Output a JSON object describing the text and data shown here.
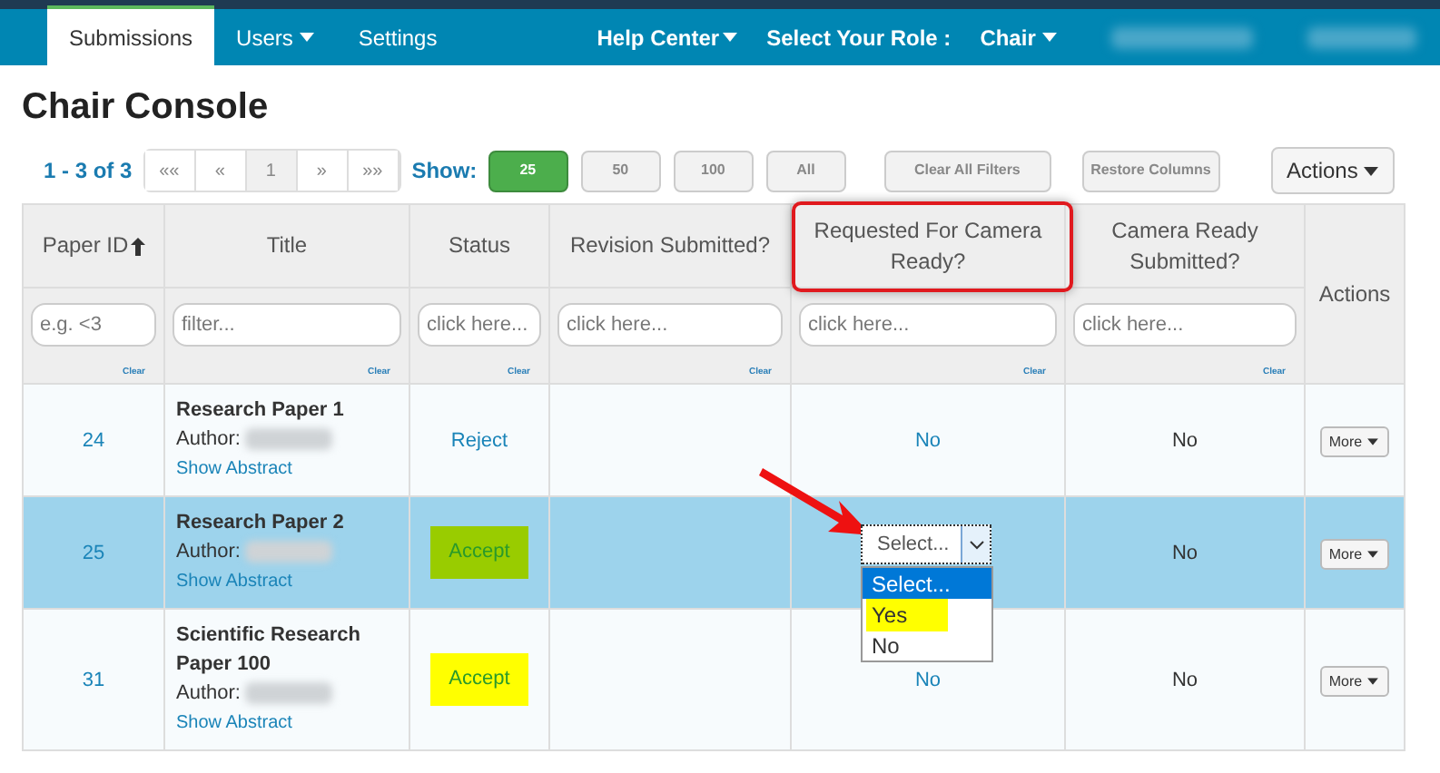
{
  "nav": {
    "tabs": [
      {
        "label": "Submissions",
        "selected": true,
        "caret": false
      },
      {
        "label": "Users",
        "selected": false,
        "caret": true
      },
      {
        "label": "Settings",
        "selected": false,
        "caret": false
      }
    ],
    "help": "Help Center",
    "role_label": "Select Your Role :",
    "role": "Chair"
  },
  "page_title": "Chair Console",
  "toolbar": {
    "range": "1 - 3 of 3",
    "pager": [
      {
        "label": "««",
        "selected": false
      },
      {
        "label": "«",
        "selected": false
      },
      {
        "label": "1",
        "selected": true
      },
      {
        "label": "»",
        "selected": false
      },
      {
        "label": "»»",
        "selected": false
      }
    ],
    "show_label": "Show:",
    "show": [
      {
        "label": "25",
        "selected": true
      },
      {
        "label": "50",
        "selected": false
      },
      {
        "label": "100",
        "selected": false
      },
      {
        "label": "All",
        "selected": false
      }
    ],
    "clear": "Clear All Filters",
    "restore": "Restore Columns",
    "actions": "Actions"
  },
  "table": {
    "columns": [
      {
        "label": "Paper ID",
        "sorted": true,
        "placeholder": "e.g. <3",
        "clear": "Clear",
        "highlighted": false
      },
      {
        "label": "Title",
        "sorted": false,
        "placeholder": "filter...",
        "clear": "Clear",
        "highlighted": false
      },
      {
        "label": "Status",
        "sorted": false,
        "placeholder": "click here...",
        "clear": "Clear",
        "highlighted": false
      },
      {
        "label": "Revision Submitted?",
        "sorted": false,
        "placeholder": "click here...",
        "clear": "Clear",
        "highlighted": false
      },
      {
        "label": "Requested For Camera Ready?",
        "sorted": false,
        "placeholder": "click here...",
        "clear": "Clear",
        "highlighted": true
      },
      {
        "label": "Camera Ready Submitted?",
        "sorted": false,
        "placeholder": "click here...",
        "clear": "Clear",
        "highlighted": false
      },
      {
        "label": "Actions",
        "sorted": false,
        "highlighted": false
      }
    ],
    "rows": [
      {
        "selected": false,
        "id": "24",
        "title": "Research Paper 1",
        "author_label": "Author:",
        "abstract": "Show Abstract",
        "status": "Reject",
        "color": null,
        "requested": {
          "kind": "text",
          "value": "No"
        },
        "camera": "No",
        "more": "More"
      },
      {
        "selected": true,
        "id": "25",
        "title": "Research Paper 2",
        "author_label": "Author:",
        "abstract": "Show Abstract",
        "status": "Accept",
        "color": "#99cc00",
        "requested": {
          "kind": "select",
          "value": "Select...",
          "options": [
            {
              "label": "Select...",
              "selected": true,
              "marked": false
            },
            {
              "label": "Yes",
              "selected": false,
              "marked": true
            },
            {
              "label": "No",
              "selected": false,
              "marked": false
            }
          ]
        },
        "camera": "No",
        "more": "More"
      },
      {
        "selected": false,
        "id": "31",
        "title": "Scientific Research Paper 100",
        "author_label": "Author:",
        "abstract": "Show Abstract",
        "status": "Accept",
        "color": "#ffff00",
        "requested": {
          "kind": "text",
          "value": "No"
        },
        "camera": "No",
        "more": "More"
      }
    ]
  }
}
